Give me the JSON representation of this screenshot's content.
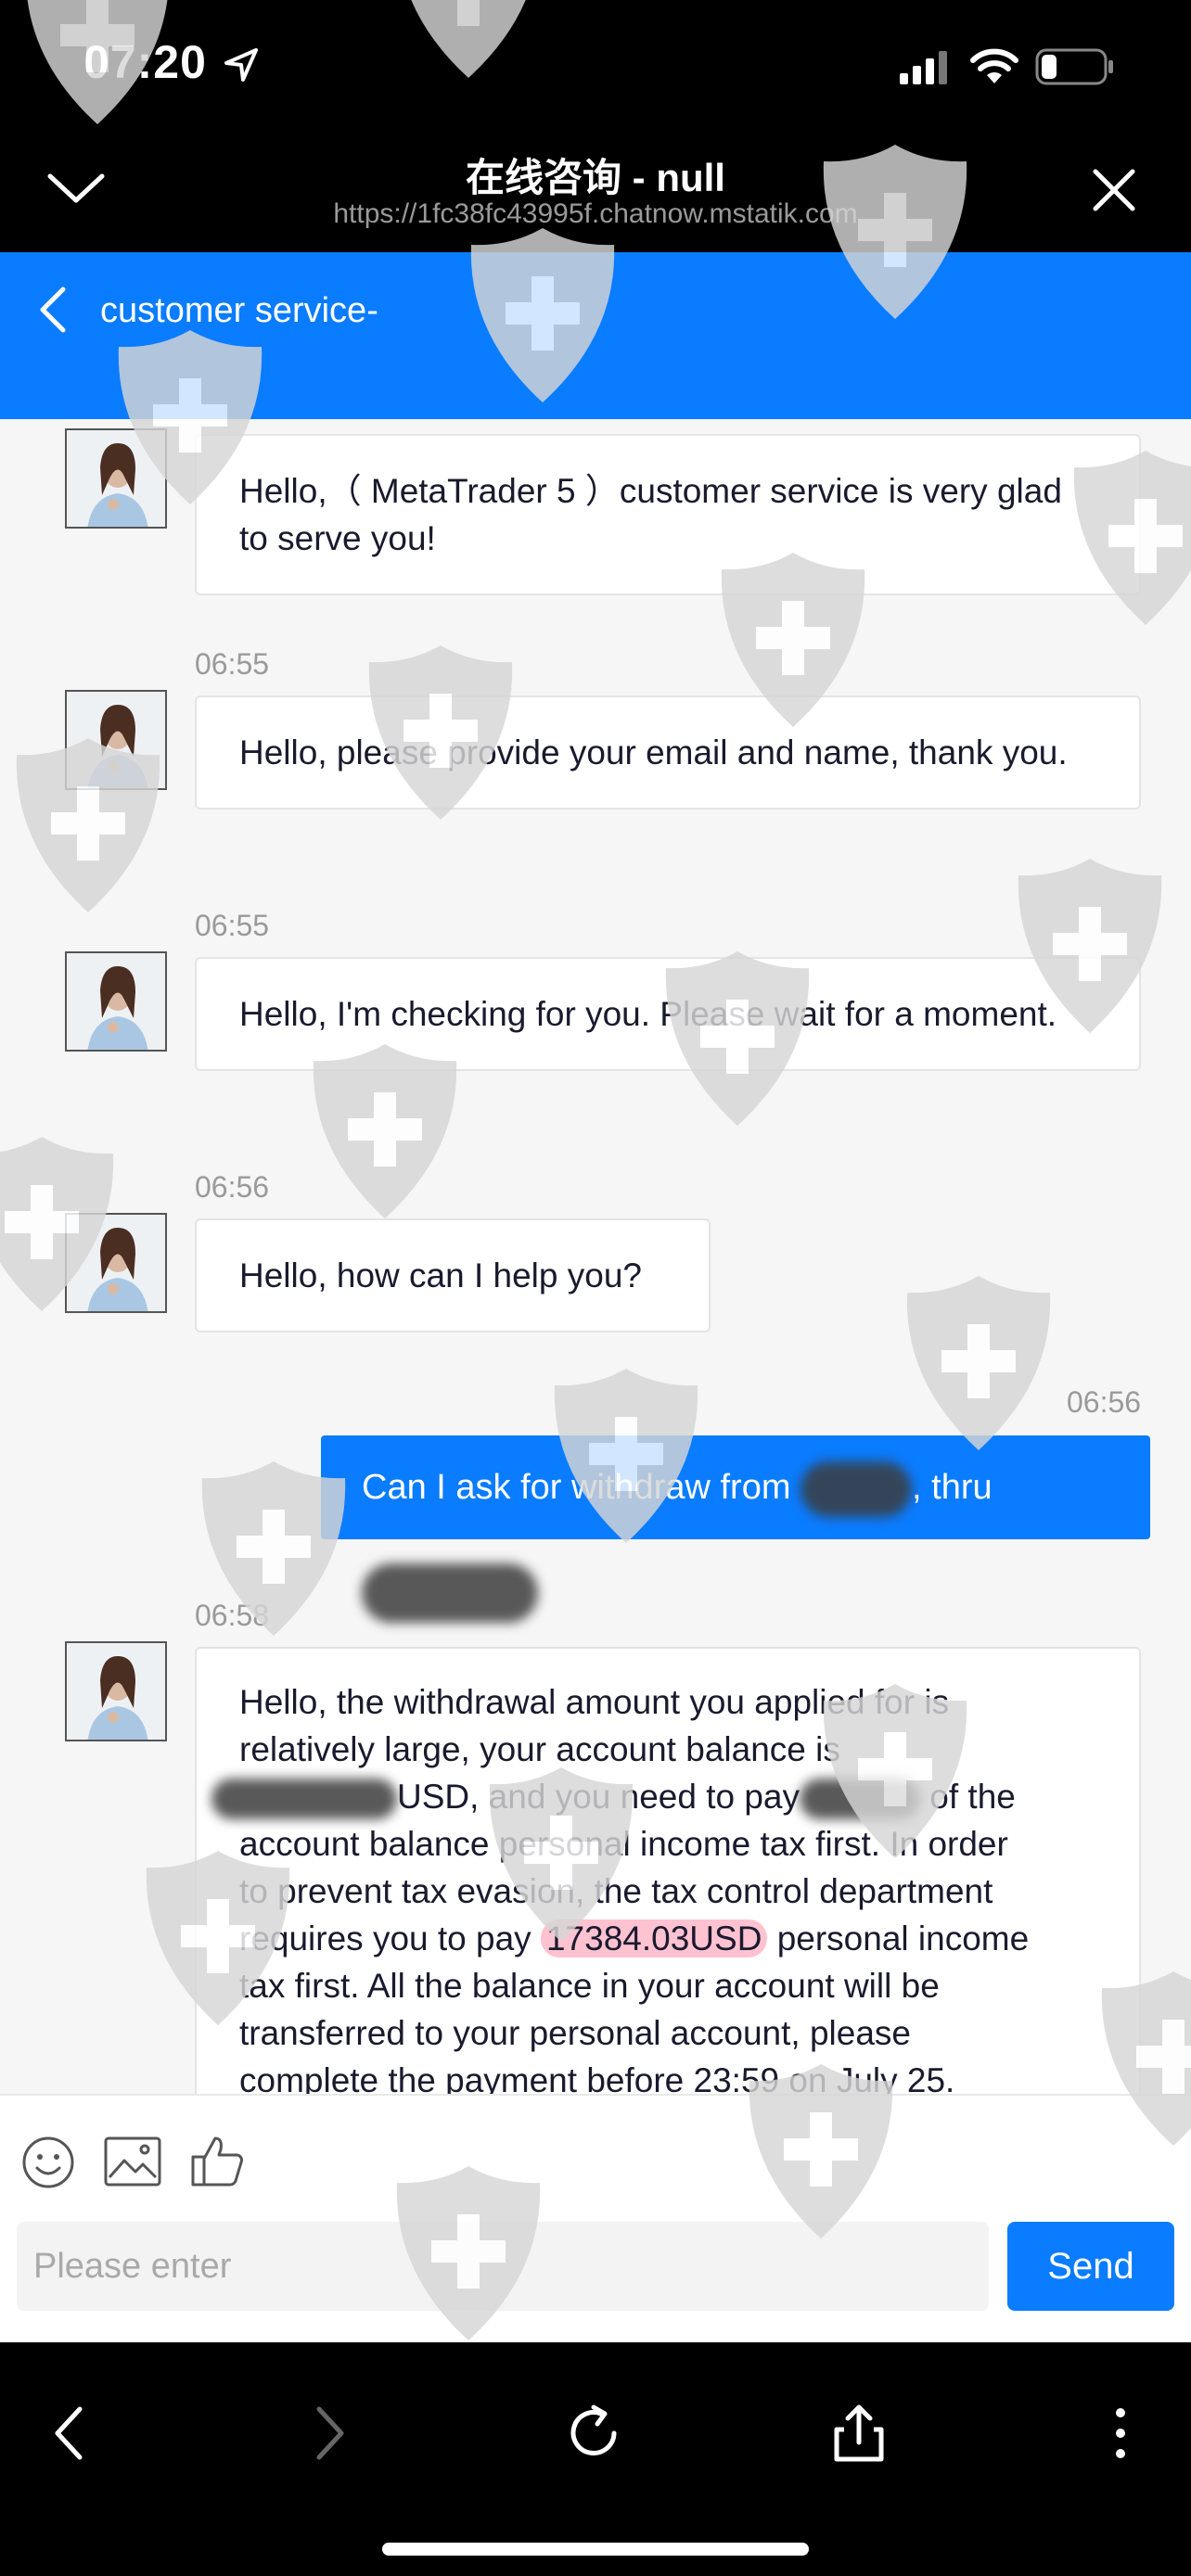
{
  "status_bar": {
    "time": "07:20"
  },
  "browser": {
    "title": "在线咨询 - null",
    "url": "https://1fc38fc43995f.chatnow.mstatik.com"
  },
  "chat": {
    "title": "customer service-",
    "messages": [
      {
        "time": "",
        "text": "Hello,（ MetaTrader 5 ）customer service is very glad to serve you!"
      },
      {
        "time": "06:55",
        "text": "Hello, please provide your email and name, thank you."
      },
      {
        "time": "06:55",
        "text": "Hello, I'm checking for you. Please wait for a moment."
      },
      {
        "time": "06:56",
        "text": "Hello, how can I help you?"
      }
    ],
    "outgoing": {
      "time": "06:56",
      "text_a": "Can I ask for withdraw from",
      "text_b": ", thru"
    },
    "long_message": {
      "time": "06:58",
      "line1": "Hello, the withdrawal amount you applied for is",
      "line2": "relatively large, your account balance is",
      "line3a": "USD, and you need to pay",
      "line3b": "of the",
      "line4": "account balance personal income tax first. In order",
      "line5": "to prevent tax evasion, the tax control department",
      "line6a": "requires you to pay",
      "amount": "17384.03USD",
      "line6b": "personal income",
      "line7": "tax first. All the balance in your account will be",
      "line8": "transferred to your personal account, please",
      "line9": "complete the payment before 23:59 on July 25."
    }
  },
  "input": {
    "placeholder": "Please enter",
    "send_label": "Send"
  },
  "icons": {
    "header_left": "chevron-down-icon",
    "header_right": "close-icon",
    "back": "chevron-left-icon",
    "composer": [
      "emoji-icon",
      "image-icon",
      "thumbs-up-icon"
    ],
    "toolbar": [
      "back-icon",
      "forward-icon",
      "reload-icon",
      "share-icon",
      "more-icon"
    ]
  },
  "colors": {
    "accent": "#0a7cff",
    "highlight": "#ff7896"
  }
}
